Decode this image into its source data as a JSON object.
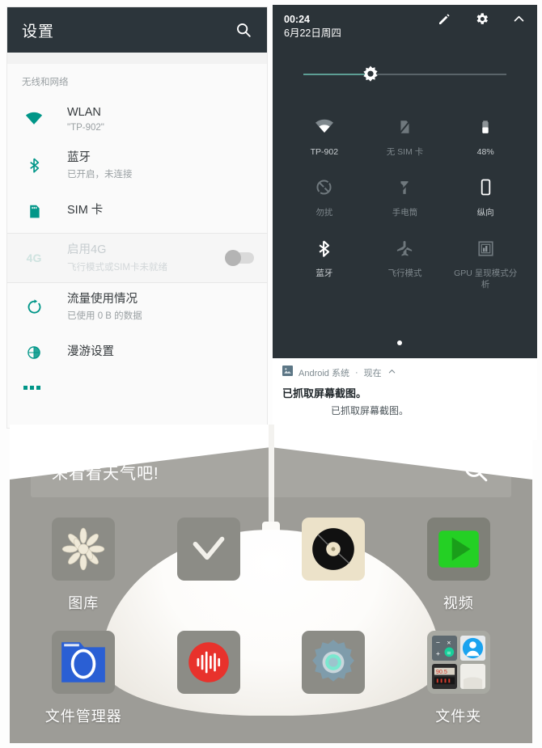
{
  "settings": {
    "appbar": {
      "title": "设置",
      "search_icon": "search-icon"
    },
    "section_label": "无线和网络",
    "rows": [
      {
        "icon": "wifi-icon",
        "label": "WLAN",
        "sub": "\"TP-902\"",
        "disabled": false,
        "toggle": false
      },
      {
        "icon": "bluetooth-icon",
        "label": "蓝牙",
        "sub": "已开启，未连接",
        "disabled": false,
        "toggle": false
      },
      {
        "icon": "sim-card-icon",
        "label": "SIM 卡",
        "sub": "",
        "disabled": false,
        "toggle": false
      },
      {
        "icon": "4g-icon",
        "label": "启用4G",
        "sub": "飞行模式或SIM卡未就绪",
        "disabled": true,
        "toggle": true
      },
      {
        "icon": "data-usage-icon",
        "label": "流量使用情况",
        "sub": "已使用 0 B 的数据",
        "disabled": false,
        "toggle": false
      },
      {
        "icon": "roaming-icon",
        "label": "漫游设置",
        "sub": "",
        "disabled": false,
        "toggle": false
      }
    ],
    "more_icon": "more-horizontal-icon",
    "accent_color": "#009688",
    "appbar_color": "#2c353b"
  },
  "quicksettings": {
    "clock": "00:24",
    "date": "6月22日周四",
    "actions": [
      {
        "name": "edit-pencil-icon",
        "label": "编辑"
      },
      {
        "name": "gear-icon",
        "label": "设置"
      },
      {
        "name": "chevron-up-icon",
        "label": "收起"
      }
    ],
    "brightness": {
      "name": "brightness-slider",
      "value_percent": 33,
      "icon": "brightness-icon"
    },
    "tiles": [
      {
        "icon": "wifi-icon",
        "label": "TP-902",
        "active": true
      },
      {
        "icon": "sim-off-icon",
        "label": "无 SIM 卡",
        "active": false
      },
      {
        "icon": "battery-icon",
        "label": "48%",
        "active": true
      },
      {
        "icon": "do-not-disturb-icon",
        "label": "勿扰",
        "active": false
      },
      {
        "icon": "flashlight-icon",
        "label": "手电筒",
        "active": false
      },
      {
        "icon": "auto-rotate-icon",
        "label": "纵向",
        "active": true
      },
      {
        "icon": "bluetooth-icon",
        "label": "蓝牙",
        "active": true
      },
      {
        "icon": "airplane-mode-icon",
        "label": "飞行模式",
        "active": false
      },
      {
        "icon": "gpu-profile-icon",
        "label": "GPU 呈现模式分析",
        "active": false
      }
    ],
    "pages": {
      "count": 2,
      "current": 1
    },
    "panel_color": "#2b3338",
    "notification": {
      "app_icon": "image-icon",
      "app_name": "Android 系统",
      "time": "现在",
      "expand_icon": "chevron-up-icon",
      "title": "已抓取屏幕截图。",
      "body": "已抓取屏幕截图。"
    }
  },
  "homescreen": {
    "search": {
      "text": "来看看天气吧!",
      "icon": "search-icon"
    },
    "apps": [
      {
        "icon": "gallery-icon",
        "label": "图库",
        "label_visible": true
      },
      {
        "icon": "checkmark-icon",
        "label": "",
        "label_visible": false
      },
      {
        "icon": "music-vinyl-icon",
        "label": "",
        "label_visible": false
      },
      {
        "icon": "video-play-icon",
        "label": "视频",
        "label_visible": true
      },
      {
        "icon": "file-manager-icon",
        "label": "文件管理器",
        "label_visible": true
      },
      {
        "icon": "recorder-icon",
        "label": "",
        "label_visible": false
      },
      {
        "icon": "settings-gear-icon",
        "label": "",
        "label_visible": false
      },
      {
        "icon": "folder-icon",
        "label": "文件夹",
        "label_visible": true
      }
    ]
  }
}
